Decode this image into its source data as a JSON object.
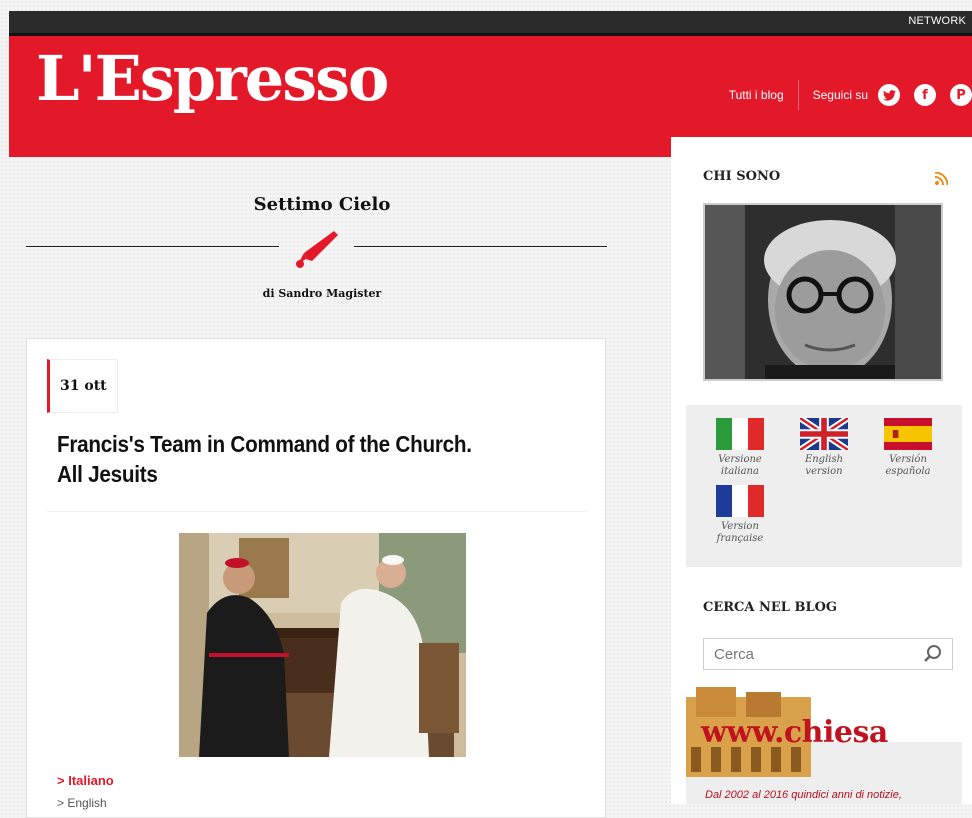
{
  "header": {
    "network_label": "NETWORK",
    "logo": "L'Espresso",
    "nav": {
      "all_blogs": "Tutti i blog",
      "follow_us": "Seguici su"
    },
    "social_icons": [
      "twitter-icon",
      "facebook-icon",
      "pinterest-icon"
    ]
  },
  "blog": {
    "title": "Settimo Cielo",
    "byline": "di Sandro Magister"
  },
  "post": {
    "date": "31 ott",
    "title_line1": "Francis's Team in Command of the Church.",
    "title_line2": "All Jesuits",
    "link_italian": "> Italiano",
    "link_english": "> English"
  },
  "sidebar": {
    "about_heading": "CHI SONO",
    "languages": [
      {
        "line1": "Versione",
        "line2": "italiana",
        "flag": "italy-flag-icon"
      },
      {
        "line1": "English",
        "line2": "version",
        "flag": "uk-flag-icon"
      },
      {
        "line1": "Versión",
        "line2": "española",
        "flag": "spain-flag-icon"
      },
      {
        "line1": "Version",
        "line2": "française",
        "flag": "france-flag-icon"
      }
    ],
    "search_heading": "CERCA NEL BLOG",
    "search_placeholder": "Cerca",
    "chiesa_logo": "www.chiesa",
    "chiesa_text": "Dal 2002 al 2016 quindici anni di notizie,"
  },
  "colors": {
    "brand_red": "#e3192a",
    "dark_bar": "#2b2b2b"
  }
}
